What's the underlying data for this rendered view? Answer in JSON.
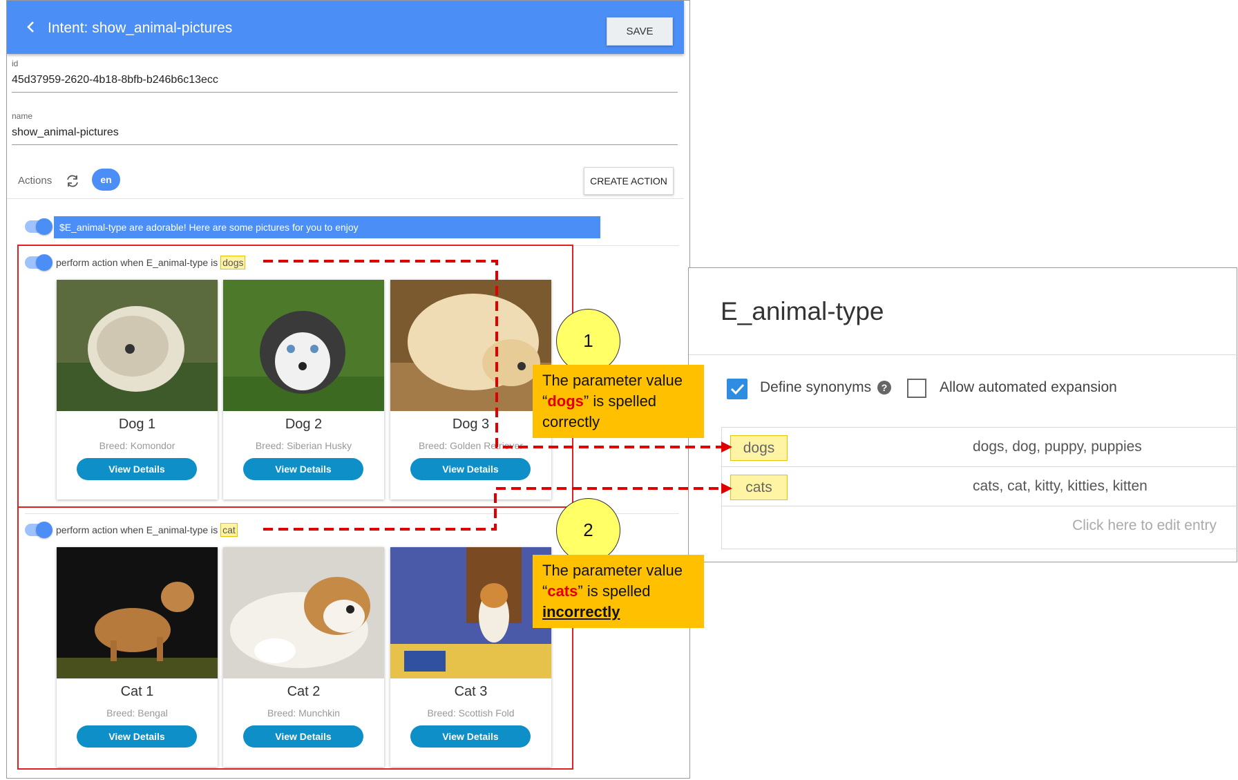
{
  "header": {
    "title": "Intent: show_animal-pictures",
    "save_label": "SAVE"
  },
  "fields": {
    "id": {
      "label": "id",
      "value": "45d37959-2620-4b18-8bfb-b246b6c13ecc"
    },
    "name": {
      "label": "name",
      "value": "show_animal-pictures"
    }
  },
  "actions": {
    "label": "Actions",
    "language": "en",
    "create_label": "CREATE ACTION"
  },
  "response": {
    "text": "$E_animal-type are adorable! Here are some pictures for you to enjoy"
  },
  "conditions": [
    {
      "prefix": "perform action when E_animal-type is",
      "value": "dogs",
      "cards": [
        {
          "title": "Dog 1",
          "breed": "Breed: Komondor",
          "button": "View Details"
        },
        {
          "title": "Dog 2",
          "breed": "Breed: Siberian Husky",
          "button": "View Details"
        },
        {
          "title": "Dog 3",
          "breed": "Breed: Golden Retriever",
          "button": "View Details"
        }
      ]
    },
    {
      "prefix": "perform action when E_animal-type is",
      "value": "cat",
      "cards": [
        {
          "title": "Cat 1",
          "breed": "Breed: Bengal",
          "button": "View Details"
        },
        {
          "title": "Cat 2",
          "breed": "Breed: Munchkin",
          "button": "View Details"
        },
        {
          "title": "Cat 3",
          "breed": "Breed: Scottish Fold",
          "button": "View Details"
        }
      ]
    }
  ],
  "entity": {
    "title": "E_animal-type",
    "define_synonyms": {
      "label": "Define synonyms",
      "checked": true
    },
    "automated_expansion": {
      "label": "Allow automated expansion",
      "checked": false
    },
    "entries": [
      {
        "value": "dogs",
        "synonyms": "dogs, dog, puppy, puppies"
      },
      {
        "value": "cats",
        "synonyms": "cats, cat, kitty, kitties, kitten"
      }
    ],
    "edit_placeholder": "Click here to edit entry"
  },
  "annotations": [
    {
      "number": "1",
      "text_before": "The parameter value “",
      "highlight": "dogs",
      "text_after": "” is spelled correctly"
    },
    {
      "number": "2",
      "text_before": "The parameter value “",
      "highlight": "cats",
      "text_after": "” is spelled",
      "emphasis": "incorrectly"
    }
  ],
  "colors": {
    "accent": "#4b8ef5",
    "button": "#0e8fc7",
    "callout": "#ffc000",
    "marker": "#ffff66",
    "connector": "#e00000"
  }
}
